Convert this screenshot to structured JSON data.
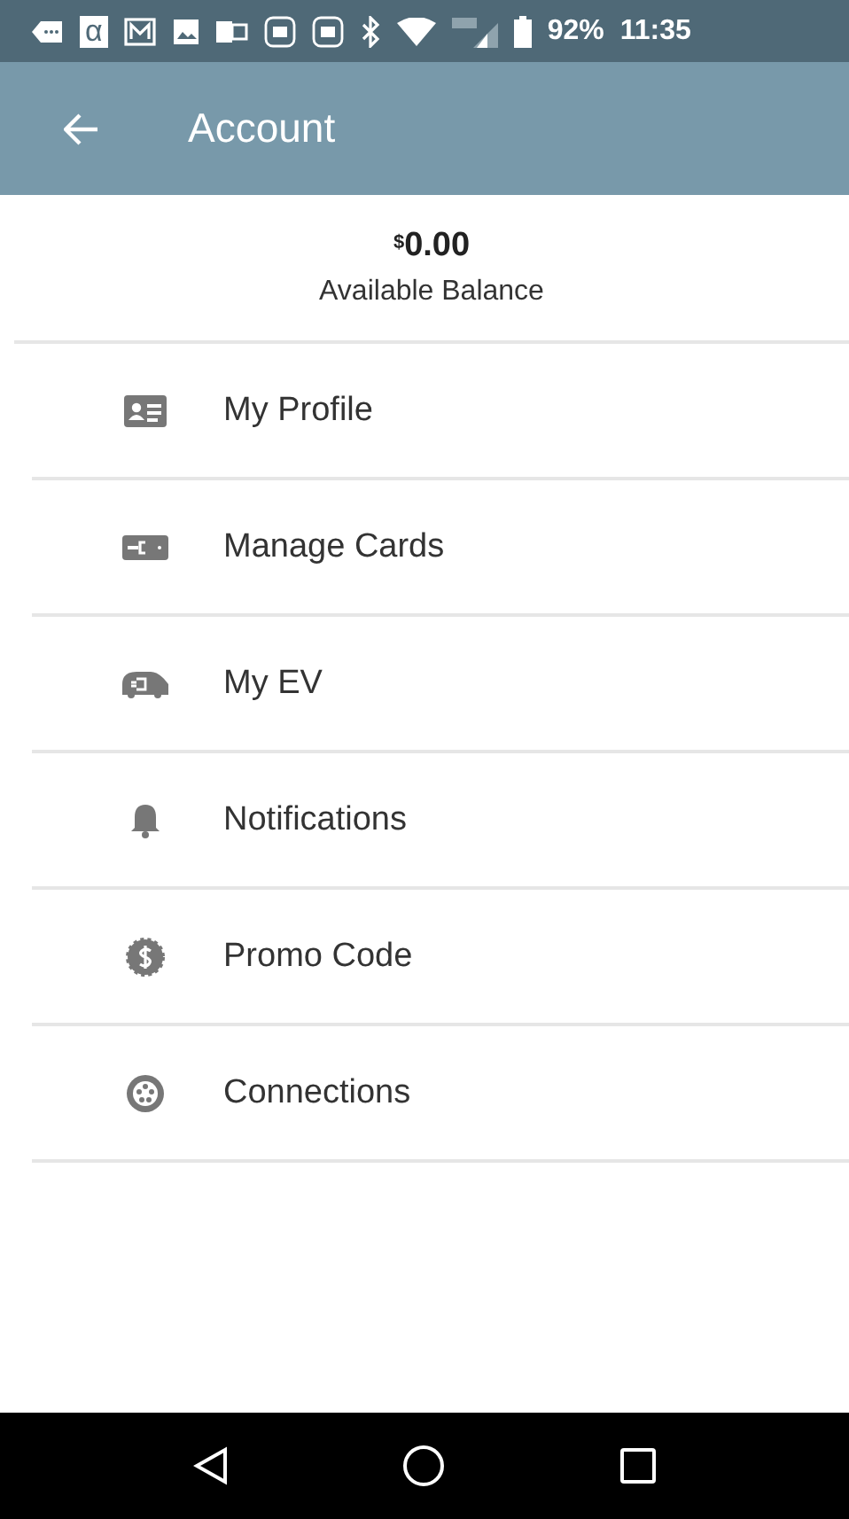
{
  "status_bar": {
    "notification_glyph": "α",
    "battery": "92%",
    "time": "11:35"
  },
  "header": {
    "title": "Account"
  },
  "balance": {
    "currency": "$",
    "amount": "0.00",
    "label": "Available Balance"
  },
  "menu": [
    {
      "kind": "profile",
      "label": "My Profile"
    },
    {
      "kind": "cards",
      "label": "Manage Cards"
    },
    {
      "kind": "ev",
      "label": "My EV"
    },
    {
      "kind": "notifications",
      "label": "Notifications"
    },
    {
      "kind": "promo",
      "label": "Promo Code"
    },
    {
      "kind": "connections",
      "label": "Connections"
    }
  ]
}
